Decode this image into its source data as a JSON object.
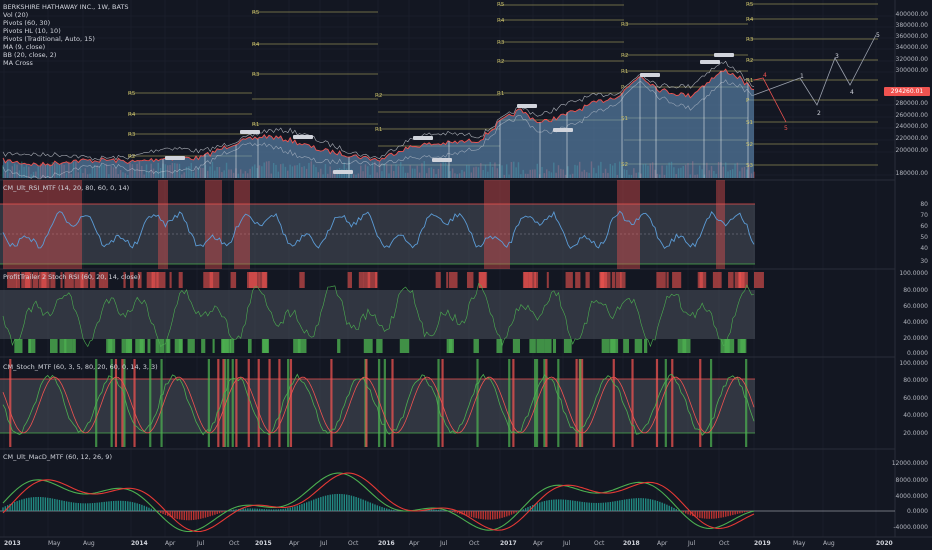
{
  "legend": {
    "symbol": "BERKSHIRE HATHAWAY INC., 1W, BATS",
    "indicators": [
      "Vol (20)",
      "Pivots (60, 30)",
      "Pivots HL (10, 10)",
      "Pivots (Traditional, Auto, 15)",
      "MA (9, close)",
      "BB (20, close, 2)",
      "MA Cross"
    ]
  },
  "last_price": "294260.01",
  "price_axis": [
    "400000.00",
    "380000.00",
    "360000.00",
    "340000.00",
    "320000.00",
    "300000.00",
    "280000.00",
    "260000.00",
    "240000.00",
    "220000.00",
    "200000.00",
    "180000.00"
  ],
  "pivot_labels": [
    {
      "text": "R5",
      "pos": "top"
    },
    {
      "text": "R4",
      "pos": "top"
    },
    {
      "text": "R3",
      "pos": "top"
    },
    {
      "text": "R2",
      "pos": "mid"
    },
    {
      "text": "R1",
      "pos": "mid"
    },
    {
      "text": "P",
      "pos": "mid"
    },
    {
      "text": "S1",
      "pos": "low"
    },
    {
      "text": "S2",
      "pos": "low"
    },
    {
      "text": "S3",
      "pos": "low"
    }
  ],
  "projection_labels": [
    "1",
    "2",
    "3",
    "4",
    "5",
    "4",
    "5"
  ],
  "panes": {
    "rsi": {
      "title": "CM_Ult_RSI_MTF (14, 20, 80, 60, 0, 14)",
      "axis": [
        "80",
        "70",
        "60",
        "50",
        "40",
        "30"
      ]
    },
    "stochrsi": {
      "title": "ProfitTrailer 2 Stoch RSI (60, 20, 14, close)",
      "axis": [
        "100.0000",
        "80.0000",
        "60.0000",
        "40.0000",
        "20.0000",
        "0.0000"
      ]
    },
    "stoch": {
      "title": "CM_Stoch_MTF (60, 3, 5, 80, 20, 60, 0, 14, 3, 3)",
      "axis": [
        "100.0000",
        "80.0000",
        "60.0000",
        "40.0000",
        "20.0000"
      ]
    },
    "macd": {
      "title": "CM_Ult_MacD_MTF (60, 12, 26, 9)",
      "axis": [
        "12000.0000",
        "8000.0000",
        "4000.0000",
        "0.0000",
        "-4000.0000"
      ]
    }
  },
  "time_axis": [
    {
      "text": "2013",
      "year": true
    },
    {
      "text": "May",
      "year": false
    },
    {
      "text": "Aug",
      "year": false
    },
    {
      "text": "2014",
      "year": true
    },
    {
      "text": "Apr",
      "year": false
    },
    {
      "text": "Jul",
      "year": false
    },
    {
      "text": "Oct",
      "year": false
    },
    {
      "text": "2015",
      "year": true
    },
    {
      "text": "Apr",
      "year": false
    },
    {
      "text": "Jul",
      "year": false
    },
    {
      "text": "Oct",
      "year": false
    },
    {
      "text": "2016",
      "year": true
    },
    {
      "text": "Apr",
      "year": false
    },
    {
      "text": "Jul",
      "year": false
    },
    {
      "text": "Oct",
      "year": false
    },
    {
      "text": "2017",
      "year": true
    },
    {
      "text": "Apr",
      "year": false
    },
    {
      "text": "Jul",
      "year": false
    },
    {
      "text": "Oct",
      "year": false
    },
    {
      "text": "2018",
      "year": true
    },
    {
      "text": "Apr",
      "year": false
    },
    {
      "text": "Jul",
      "year": false
    },
    {
      "text": "Oct",
      "year": false
    },
    {
      "text": "2019",
      "year": true
    },
    {
      "text": "May",
      "year": false
    },
    {
      "text": "Aug",
      "year": false
    },
    {
      "text": "2020",
      "year": true
    }
  ],
  "colors": {
    "background": "#131722",
    "price_area": "#6a9bc9",
    "bull": "#26a69a",
    "bear": "#ef5350",
    "pivot_line": "#c9c06a",
    "rsi_line": "#5b9bd5",
    "stoch_green": "#4caf50",
    "macd_red": "#e53935",
    "macd_green": "#2e7d32"
  }
}
